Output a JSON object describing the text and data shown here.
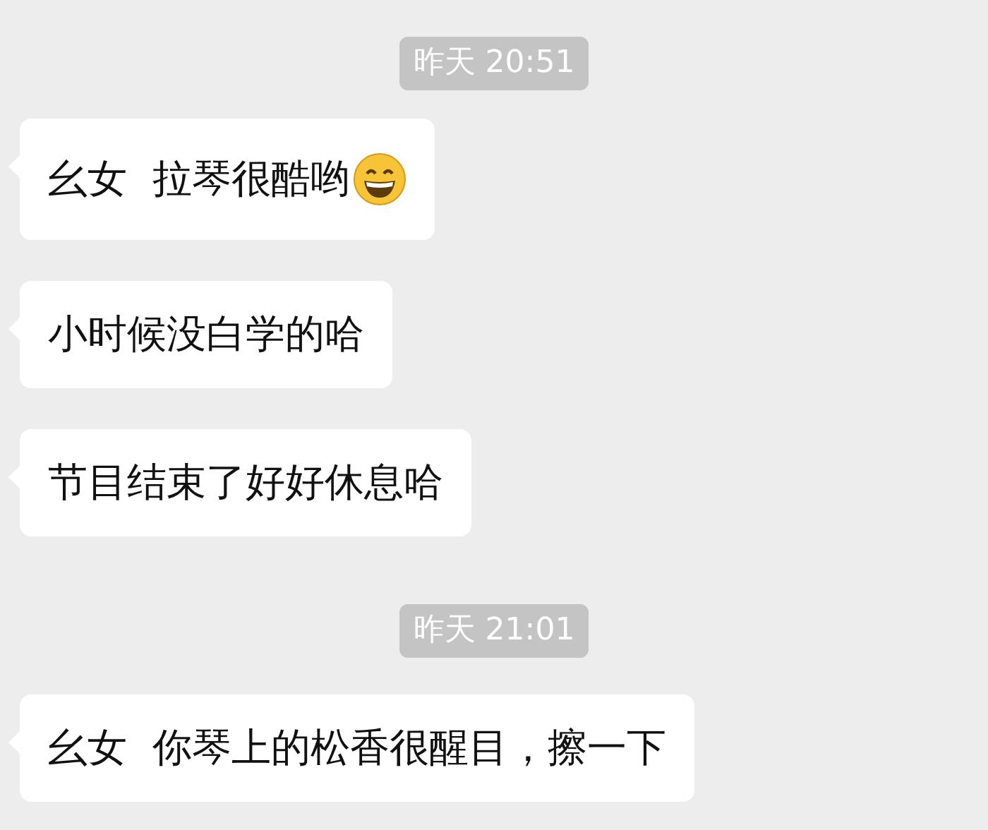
{
  "messages": [
    {
      "kind": "timestamp",
      "text": "昨天 20:51"
    },
    {
      "kind": "bubble",
      "text": "幺女  拉琴很酷哟",
      "emoji": true
    },
    {
      "kind": "bubble",
      "text": "小时候没白学的哈",
      "emoji": false
    },
    {
      "kind": "bubble",
      "text": "节目结束了好好休息哈",
      "emoji": false
    },
    {
      "kind": "timestamp",
      "text": "昨天 21:01"
    },
    {
      "kind": "bubble",
      "text": "幺女  你琴上的松香很醒目，擦一下",
      "emoji": false
    }
  ]
}
